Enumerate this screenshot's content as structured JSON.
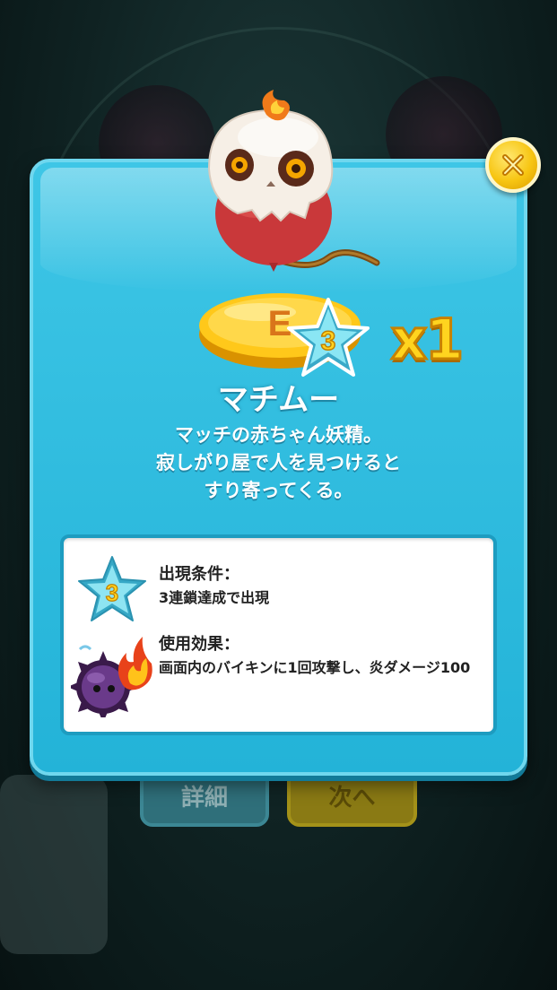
{
  "modal": {
    "character_name": "マチムー",
    "description_lines": [
      "マッチの赤ちゃん妖精。",
      "寂しがり屋で人を見つけると",
      "すり寄ってくる。"
    ],
    "coin_letter": "E",
    "rank": "3",
    "count": "x1",
    "appear_condition_label": "出現条件：",
    "appear_condition_text": "3連鎖達成で出現",
    "effect_label": "使用効果：",
    "effect_text": "画面内のバイキンに1回攻撃し、炎ダメージ100",
    "close_icon": "close-icon"
  },
  "background": {
    "detail_button": "詳細",
    "next_button": "次へ"
  },
  "colors": {
    "panel": "#2bbbdf",
    "gold": "#f7c512",
    "star": "#7fe0f0"
  }
}
